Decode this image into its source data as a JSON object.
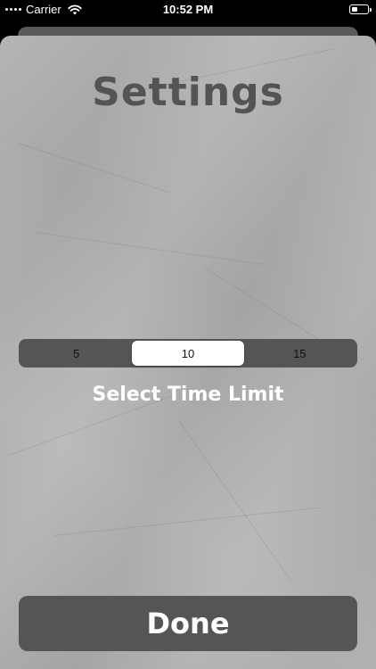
{
  "status_bar": {
    "carrier": "Carrier",
    "time": "10:52 PM",
    "icons": [
      "signal-dots-icon",
      "wifi-icon",
      "battery-icon"
    ]
  },
  "settings": {
    "title": "Settings",
    "time_limit": {
      "options": [
        "5",
        "10",
        "15"
      ],
      "selected": "10",
      "label": "Select Time Limit"
    },
    "done_label": "Done"
  },
  "colors": {
    "background": "#b4b4b4",
    "control": "#555555",
    "selected_segment": "#ffffff",
    "title_text": "#545454"
  }
}
